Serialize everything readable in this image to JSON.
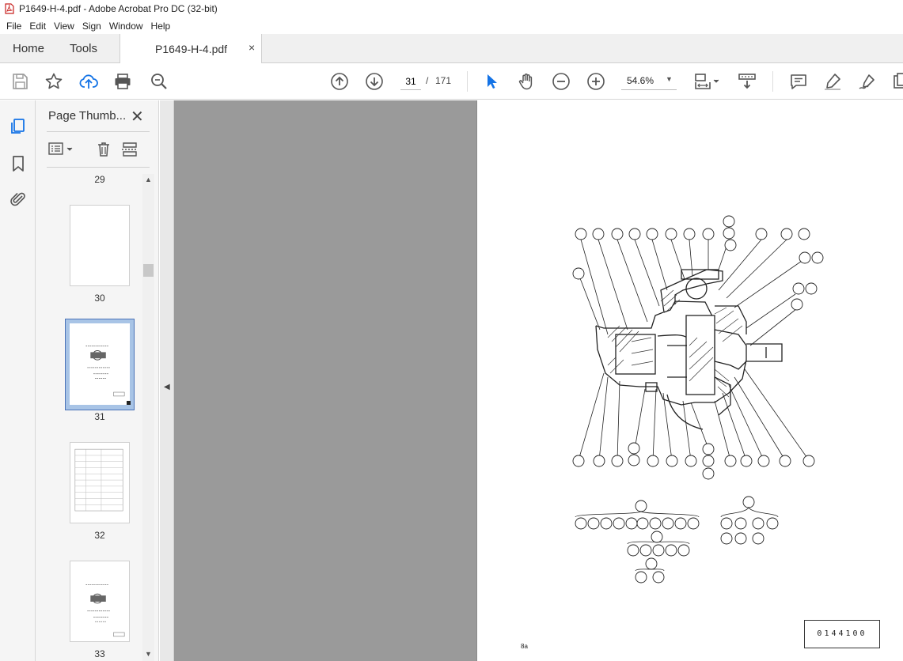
{
  "window": {
    "title": "P1649-H-4.pdf - Adobe Acrobat Pro DC (32-bit)"
  },
  "menu": [
    "File",
    "Edit",
    "View",
    "Sign",
    "Window",
    "Help"
  ],
  "tabs": {
    "home": "Home",
    "tools": "Tools",
    "document": "P1649-H-4.pdf",
    "close": "×"
  },
  "toolbar": {
    "current_page": "31",
    "page_separator": "/",
    "total_pages": "171",
    "zoom": "54.6%",
    "zoom_caret": "▼",
    "icons": [
      "save-icon",
      "star-icon",
      "upload-cloud-icon",
      "print-icon",
      "zoom-search-icon",
      "page-up-icon",
      "page-down-icon",
      "select-arrow-icon",
      "hand-icon",
      "zoom-out-icon",
      "zoom-in-icon",
      "page-fit-icon",
      "scroll-mode-icon",
      "comment-icon",
      "highlight-icon",
      "sign-icon"
    ]
  },
  "panel": {
    "title": "Page Thumb...",
    "close": "✕",
    "thumbnails": [
      {
        "label": "29"
      },
      {
        "label": "30"
      },
      {
        "label": "31",
        "selected": true
      },
      {
        "label": "32"
      },
      {
        "label": "33"
      }
    ]
  },
  "document": {
    "drawing_code": "0144100",
    "page_number": "8a"
  },
  "colors": {
    "accent": "#1473e6",
    "selection": "#a8c4e6",
    "canvas": "#9a9a9a"
  }
}
